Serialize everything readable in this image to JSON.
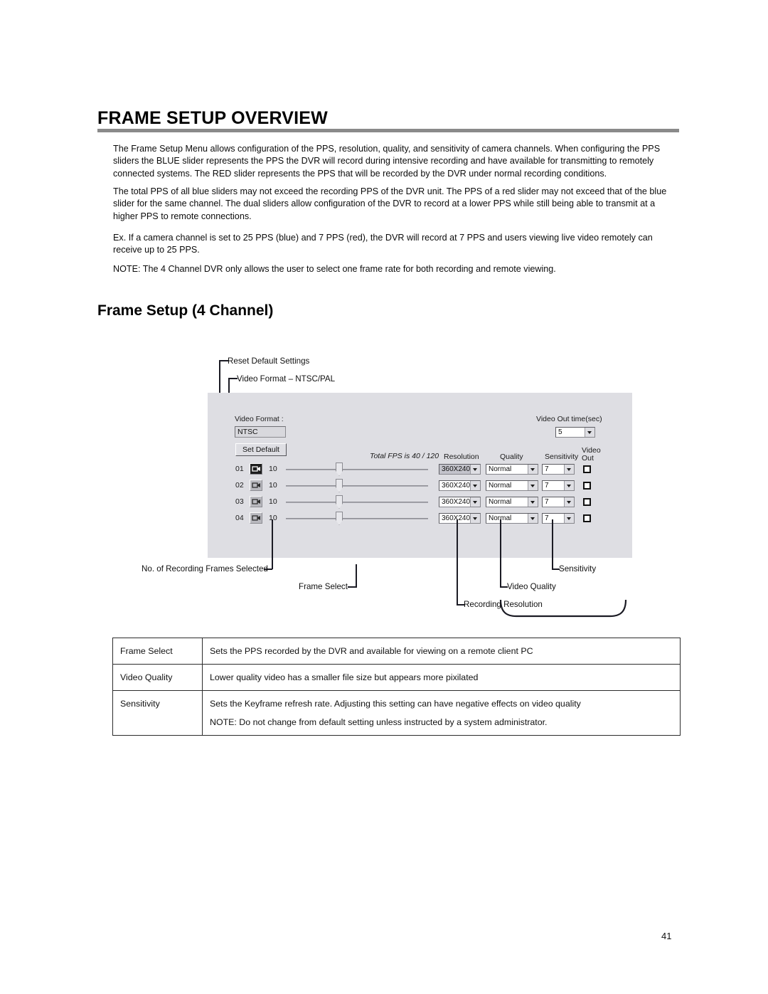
{
  "page": {
    "title": "FRAME SETUP OVERVIEW",
    "section_title": "Frame Setup (4 Channel)",
    "number": "41"
  },
  "paragraphs": [
    "The Frame Setup Menu allows configuration of the PPS, resolution, quality, and sensitivity of camera channels. When configuring the PPS sliders the BLUE slider represents the PPS the DVR will record during intensive recording and have available for transmitting to remotely connected systems. The RED slider represents the PPS that will be recorded by the DVR under normal recording conditions.",
    "The total PPS of all blue sliders may not exceed the recording PPS of the DVR unit. The PPS of a red slider may not exceed that of the blue slider for the same channel. The dual sliders allow configuration of the DVR to record at a lower PPS while still being able to transmit at a higher PPS to remote connections.",
    "Ex. If a camera channel is set to 25 PPS (blue) and 7 PPS (red), the DVR will record at 7 PPS and users viewing live video remotely can receive up to 25 PPS.",
    "NOTE: The 4 Channel DVR only allows the user to select one frame rate for both recording and remote viewing."
  ],
  "callouts": {
    "reset_default_settings": "Reset Default Settings",
    "video_format_ntsc_pal": "Video Format – NTSC/PAL",
    "no_of_recording_frames_selected": "No. of Recording Frames Selected",
    "frame_select": "Frame Select",
    "recording_resolution": "Recording Resolution",
    "video_quality": "Video Quality",
    "sensitivity": "Sensitivity"
  },
  "dialog": {
    "video_format_label": "Video Format :",
    "video_format_value": "NTSC",
    "set_default_button": "Set Default",
    "video_out_time_label": "Video Out time(sec)",
    "video_out_time_value": "5",
    "total_fps_label": "Total FPS is 40 / 120",
    "column_headers": {
      "resolution": "Resolution",
      "quality": "Quality",
      "sensitivity": "Sensitivity",
      "video_out_line1": "Video",
      "video_out_line2": "Out"
    },
    "channels": [
      {
        "num": "01",
        "icon": "camera-icon",
        "icon_state": "dark",
        "frames": "10",
        "resolution": "360X240",
        "resolution_state": "grayed",
        "quality": "Normal",
        "sensitivity": "7",
        "video_out_checked": false
      },
      {
        "num": "02",
        "icon": "camera-icon",
        "icon_state": "light",
        "frames": "10",
        "resolution": "360X240",
        "resolution_state": "normal",
        "quality": "Normal",
        "sensitivity": "7",
        "video_out_checked": false
      },
      {
        "num": "03",
        "icon": "camera-icon",
        "icon_state": "light",
        "frames": "10",
        "resolution": "360X240",
        "resolution_state": "normal",
        "quality": "Normal",
        "sensitivity": "7",
        "video_out_checked": false
      },
      {
        "num": "04",
        "icon": "camera-icon",
        "icon_state": "light",
        "frames": "10",
        "resolution": "360X240",
        "resolution_state": "normal",
        "quality": "Normal",
        "sensitivity": "7",
        "video_out_checked": false
      }
    ]
  },
  "info_table": {
    "rows": [
      {
        "label": "Frame Select",
        "text": "Sets the PPS recorded by the DVR and available for viewing on a remote client PC",
        "note": ""
      },
      {
        "label": "Video Quality",
        "text": "Lower quality video has a smaller file size but appears more pixilated",
        "note": ""
      },
      {
        "label": "Sensitivity",
        "text": "Sets the Keyframe refresh rate.  Adjusting this setting can have negative effects on video quality",
        "note": "NOTE:  Do not change from default setting unless instructed by a system administrator."
      }
    ]
  },
  "colors": {
    "rule": "#8a8a8a",
    "panel_background": "#dedee3",
    "callout_line": "#1b1b24"
  }
}
